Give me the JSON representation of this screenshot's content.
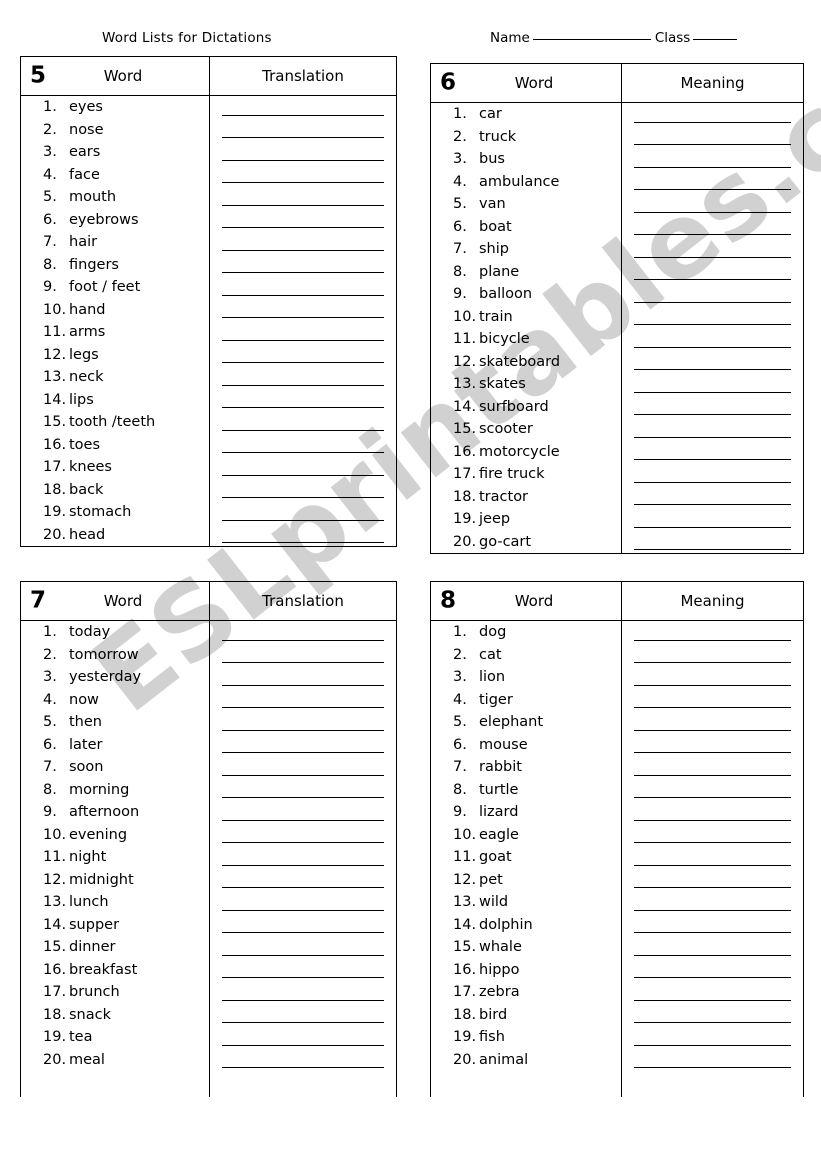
{
  "header": {
    "title": "Word Lists for Dictations",
    "name_label": "Name",
    "class_label": "Class"
  },
  "watermark": {
    "text": "ESLprintables.com"
  },
  "columns": {
    "word": "Word",
    "translation": "Translation",
    "meaning": "Meaning"
  },
  "lists": [
    {
      "number": "5",
      "word_header": "Word",
      "answer_header": "Translation",
      "items": [
        "eyes",
        "nose",
        "ears",
        "face",
        "mouth",
        "eyebrows",
        "hair",
        "fingers",
        "foot / feet",
        "hand",
        "arms",
        "legs",
        "neck",
        "lips",
        "tooth /teeth",
        "toes",
        "knees",
        "back",
        "stomach",
        "head"
      ]
    },
    {
      "number": "6",
      "word_header": "Word",
      "answer_header": "Meaning",
      "items": [
        "car",
        "truck",
        "bus",
        "ambulance",
        "van",
        "boat",
        "ship",
        "plane",
        "balloon",
        "train",
        "bicycle",
        "skateboard",
        "skates",
        "surfboard",
        "scooter",
        "motorcycle",
        "fire truck",
        "tractor",
        "jeep",
        "go-cart"
      ]
    },
    {
      "number": "7",
      "word_header": "Word",
      "answer_header": "Translation",
      "items": [
        "today",
        "tomorrow",
        "yesterday",
        "now",
        "then",
        "later",
        "soon",
        "morning",
        "afternoon",
        "evening",
        "night",
        "midnight",
        "lunch",
        "supper",
        "dinner",
        "breakfast",
        "brunch",
        "snack",
        "tea",
        "meal"
      ]
    },
    {
      "number": "8",
      "word_header": "Word",
      "answer_header": "Meaning",
      "items": [
        "dog",
        "cat",
        "lion",
        "tiger",
        "elephant",
        "mouse",
        "rabbit",
        "turtle",
        "lizard",
        "eagle",
        "goat",
        "pet",
        "wild",
        "dolphin",
        "whale",
        "hippo",
        "zebra",
        "bird",
        "fish",
        "animal"
      ]
    }
  ]
}
